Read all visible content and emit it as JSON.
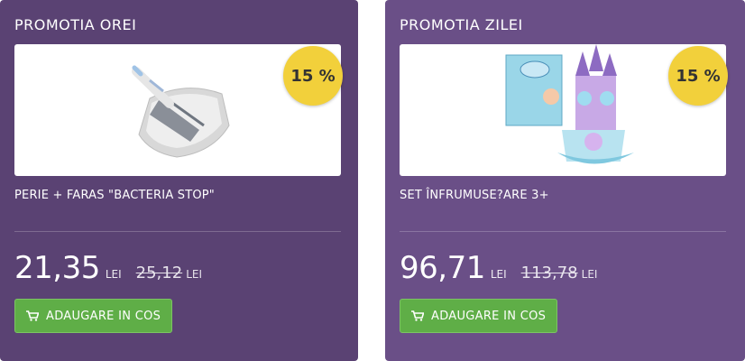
{
  "promos": [
    {
      "title": "PROMOTIA OREI",
      "discount": "15 %",
      "product_name": "PERIE + FARAS \"BACTERIA STOP\"",
      "price": "21,35",
      "currency": "LEI",
      "old_price": "25,12",
      "old_currency": "LEI",
      "button_label": "ADAUGARE IN COS",
      "image": "brush-dustpan-image"
    },
    {
      "title": "PROMOTIA ZILEI",
      "discount": "15 %",
      "product_name": "SET ÎNFRUMUSE?ARE 3+",
      "price": "96,71",
      "currency": "LEI",
      "old_price": "113,78",
      "old_currency": "LEI",
      "button_label": "ADAUGARE IN COS",
      "image": "beauty-castle-toy-image"
    }
  ],
  "colors": {
    "card_left": "#5a4273",
    "card_right": "#6a4f87",
    "badge": "#f2d03b",
    "button": "#5fae47"
  }
}
